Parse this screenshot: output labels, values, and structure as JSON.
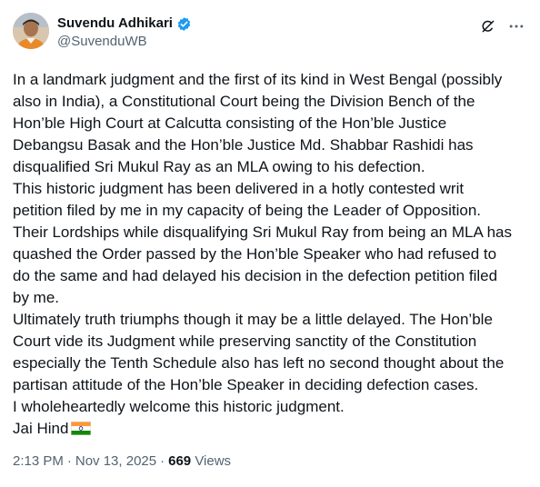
{
  "author": {
    "display_name": "Suvendu Adhikari",
    "handle": "@SuvenduWB",
    "verified_icon": "verified-badge-icon",
    "verified_color": "#1d9bf0"
  },
  "tweet": {
    "lines": [
      "In a landmark judgment and the first of its kind in West Bengal (possibly",
      "also in India), a Constitutional Court being the Division Bench of the",
      "Hon’ble High Court at Calcutta consisting of the Hon’ble Justice",
      "Debangsu Basak and the Hon’ble Justice Md. Shabbar Rashidi has",
      "disqualified Sri Mukul Ray as an MLA owing to his defection.",
      "This historic judgment has been delivered in a hotly contested writ",
      "petition filed by me in my capacity of being the Leader of Opposition.",
      "Their Lordships while disqualifying Sri Mukul Ray from being an MLA has",
      "quashed the Order passed by the Hon’ble Speaker who had refused to",
      "do the same and had delayed his decision in the defection petition filed",
      "by me.",
      "Ultimately truth triumphs though it may be a little delayed. The Hon’ble",
      "Court vide its Judgment while preserving sanctity of the Constitution",
      "especially the Tenth Schedule also has left no second thought about the",
      "partisan attitude of the Hon’ble Speaker in deciding defection cases.",
      "I wholeheartedly welcome this historic judgment.",
      "Jai Hind"
    ],
    "emoji": "india-flag-icon"
  },
  "meta": {
    "time": "2:13 PM",
    "separator": "·",
    "date": "Nov 13, 2025",
    "views_count": "669",
    "views_label": "Views"
  },
  "icons": {
    "grok": "grok-icon",
    "more": "more-icon"
  },
  "colors": {
    "text": "#0f1419",
    "secondary": "#536471",
    "accent": "#1d9bf0"
  }
}
